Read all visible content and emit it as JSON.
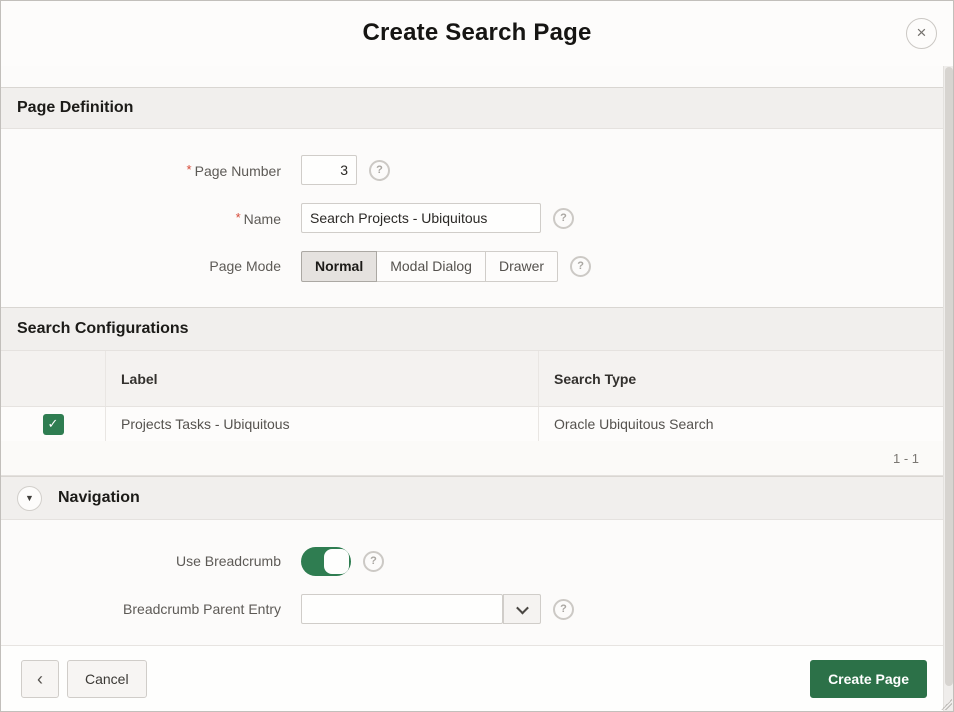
{
  "dialog": {
    "title": "Create Search Page"
  },
  "icons": {
    "close": "×",
    "help": "?",
    "check": "✓",
    "collapse_triangle": "▼",
    "back_chevron": "‹"
  },
  "page_definition": {
    "section_title": "Page Definition",
    "page_number": {
      "label": "Page Number",
      "required": "*",
      "value": "3"
    },
    "name": {
      "label": "Name",
      "required": "*",
      "value": "Search Projects - Ubiquitous"
    },
    "page_mode": {
      "label": "Page Mode",
      "options": [
        "Normal",
        "Modal Dialog",
        "Drawer"
      ],
      "selected": "Normal"
    }
  },
  "search_configurations": {
    "section_title": "Search Configurations",
    "columns": {
      "label": "Label",
      "search_type": "Search Type"
    },
    "rows": [
      {
        "checked": true,
        "label": "Projects Tasks - Ubiquitous",
        "search_type": "Oracle Ubiquitous Search"
      }
    ],
    "pagination": "1 - 1"
  },
  "navigation": {
    "section_title": "Navigation",
    "use_breadcrumb": {
      "label": "Use Breadcrumb",
      "state": "on"
    },
    "breadcrumb_parent_entry": {
      "label": "Breadcrumb Parent Entry",
      "value": ""
    }
  },
  "footer": {
    "cancel_label": "Cancel",
    "create_label": "Create Page"
  },
  "colors": {
    "accent_green": "#2f7d51",
    "button_green": "#2c7148",
    "required_red": "#d64937",
    "section_header_bg": "#f1efed"
  }
}
